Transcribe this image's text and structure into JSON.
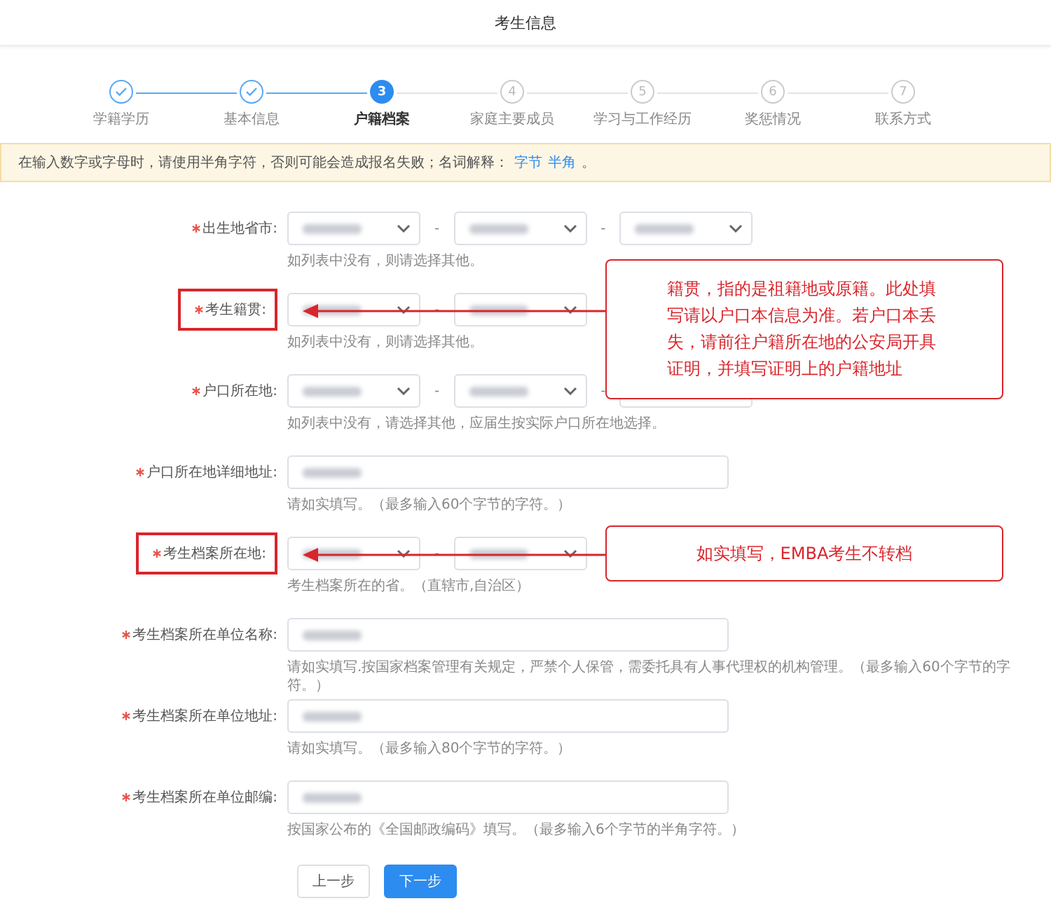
{
  "title": "考生信息",
  "steps": [
    {
      "label": "学籍学历",
      "completed": true,
      "selected": false
    },
    {
      "label": "基本信息",
      "completed": true,
      "selected": false
    },
    {
      "label": "户籍档案",
      "number": "3",
      "completed": false,
      "selected": true
    },
    {
      "label": "家庭主要成员",
      "number": "4",
      "completed": false,
      "selected": false
    },
    {
      "label": "学习与工作经历",
      "number": "5",
      "completed": false,
      "selected": false
    },
    {
      "label": "奖惩情况",
      "number": "6",
      "completed": false,
      "selected": false
    },
    {
      "label": "联系方式",
      "number": "7",
      "completed": false,
      "selected": false
    }
  ],
  "notice": {
    "text": "在输入数字或字母时，请使用半角字符，否则可能会造成报名失败；名词解释：",
    "links": [
      "字节",
      "半角"
    ],
    "end": "。"
  },
  "fields": [
    {
      "label": "出生地省市:",
      "kind": "triple-select",
      "separator": "-",
      "required": true,
      "highlighted": false,
      "hint": "如列表中没有，则请选择其他。"
    },
    {
      "label": "考生籍贯:",
      "kind": "double-select",
      "separator": "-",
      "required": true,
      "highlighted": true,
      "hint": "如列表中没有，则请选择其他。"
    },
    {
      "label": "户口所在地:",
      "kind": "triple-select-partly-covered",
      "separator": "-",
      "required": true,
      "highlighted": false,
      "hint": "如列表中没有，请选择其他，应届生按实际户口所在地选择。"
    },
    {
      "label": "户口所在地详细地址:",
      "kind": "text",
      "required": true,
      "highlighted": false,
      "hint": "请如实填写。（最多输入60个字节的字符。）"
    },
    {
      "label": "考生档案所在地:",
      "kind": "double-select",
      "separator": "-",
      "required": true,
      "highlighted": true,
      "hint": "考生档案所在的省。（直辖市,自治区）"
    },
    {
      "label": "考生档案所在单位名称:",
      "kind": "text",
      "required": true,
      "highlighted": false,
      "hint": "请如实填写.按国家档案管理有关规定，严禁个人保管，需委托具有人事代理权的机构管理。（最多输入60个字节的字符。）"
    },
    {
      "label": "考生档案所在单位地址:",
      "kind": "text",
      "required": true,
      "highlighted": false,
      "hint": "请如实填写。（最多输入80个字节的字符。）"
    },
    {
      "label": "考生档案所在单位邮编:",
      "kind": "text",
      "required": true,
      "highlighted": false,
      "hint": "按国家公布的《全国邮政编码》填写。（最多输入6个字节的半角字符。）"
    }
  ],
  "buttons": [
    {
      "label": "上一步",
      "kind": "default"
    },
    {
      "label": "下一步",
      "kind": "primary"
    }
  ],
  "callouts": [
    {
      "text": "籍贯，指的是祖籍地或原籍。此处填写请以户口本信息为准。若户口本丢失，请前往户籍所在地的公安局开具证明，并填写证明上的户籍地址"
    },
    {
      "text": "如实填写，EMBA考生不转档"
    }
  ]
}
